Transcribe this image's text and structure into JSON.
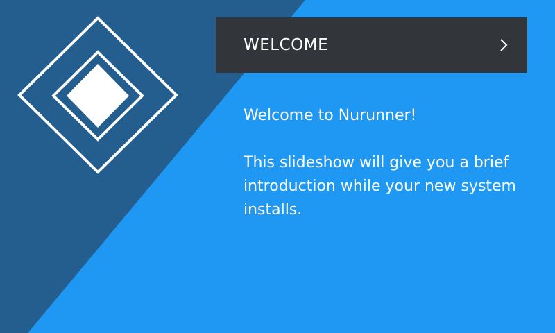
{
  "colors": {
    "background_light": "#1e98f2",
    "background_dark": "#245e8f",
    "title_bar": "#32363a",
    "text": "#ffffff"
  },
  "header": {
    "title": "WELCOME",
    "next_icon": "chevron-right-icon"
  },
  "logo": {
    "icon": "nested-diamond-logo-icon"
  },
  "content": {
    "greeting": "Welcome to Nurunner!",
    "description": "This slideshow will give you a brief introduction while your new system installs."
  }
}
